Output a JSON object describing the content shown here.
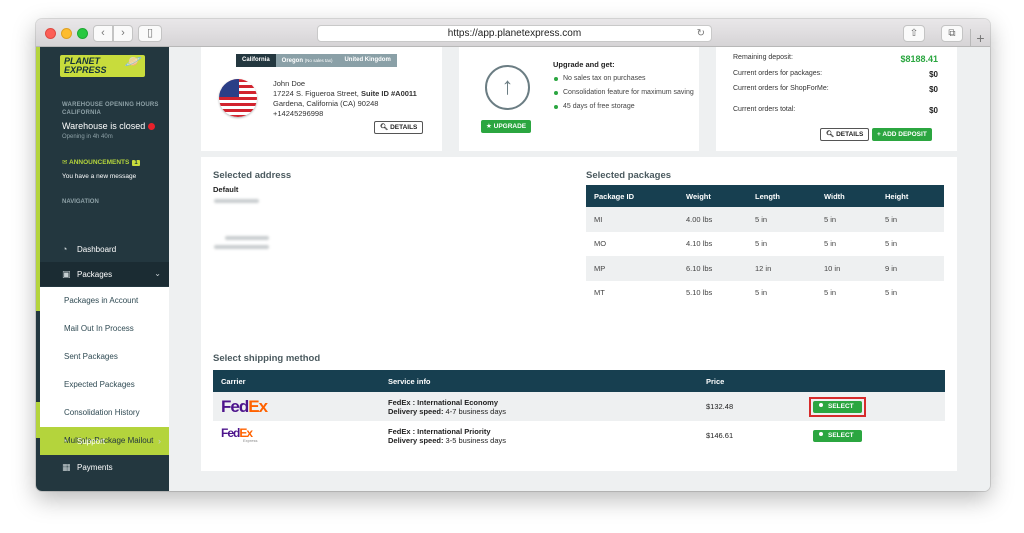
{
  "browser": {
    "url": "https://app.planetexpress.com",
    "reload_icon": "↻",
    "back_icon": "‹",
    "forward_icon": "›",
    "sidebar_icon": "▯",
    "share_icon": "⇧",
    "tabs_icon": "⧉",
    "newtab_icon": "+"
  },
  "sidebar": {
    "logo": "PLANET EXPRESS",
    "hours_title": "WAREHOUSE OPENING HOURS CALIFORNIA",
    "status": "Warehouse is closed",
    "opening": "Opening in 4h 40m",
    "announcements_label": "ANNOUNCEMENTS",
    "announcements_count": "1",
    "message": "You have a new message",
    "nav_heading": "NAVIGATION",
    "dashboard": "Dashboard",
    "packages": "Packages",
    "submenu": [
      "Packages in Account",
      "Mail Out In Process",
      "Sent Packages",
      "Expected Packages",
      "Consolidation History",
      "Multiple-Package Mailout"
    ],
    "support": "Support",
    "payments": "Payments"
  },
  "address_card": {
    "tabs": [
      "California",
      "Oregon",
      "(No sales tax)",
      "United Kingdom"
    ],
    "name": "John Doe",
    "street": "17224 S. Figueroa Street,",
    "suite": "Suite ID #A0011",
    "city": "Gardena, California (CA) 90248",
    "phone": "+14245296998",
    "details_btn": "DETAILS"
  },
  "upgrade_card": {
    "title": "Upgrade and get:",
    "benefits": [
      "No sales tax on purchases",
      "Consolidation feature for maximum saving",
      "45 days of free storage"
    ],
    "button": "UPGRADE"
  },
  "deposit_card": {
    "remaining_label": "Remaining deposit:",
    "remaining_value": "$8188.41",
    "orders_packages_label": "Current orders for packages:",
    "orders_packages_value": "$0",
    "orders_shop_label": "Current orders for ShopForMe:",
    "orders_shop_value": "$0",
    "orders_total_label": "Current orders total:",
    "orders_total_value": "$0",
    "details_btn": "DETAILS",
    "add_btn": "ADD DEPOSIT"
  },
  "selected_address": {
    "title": "Selected address",
    "default_label": "Default"
  },
  "selected_packages": {
    "title": "Selected packages",
    "columns": [
      "Package ID",
      "Weight",
      "Length",
      "Width",
      "Height"
    ],
    "rows": [
      [
        "MI",
        "4.00 lbs",
        "5 in",
        "5 in",
        "5 in"
      ],
      [
        "MO",
        "4.10 lbs",
        "5 in",
        "5 in",
        "5 in"
      ],
      [
        "MP",
        "6.10 lbs",
        "12 in",
        "10 in",
        "9 in"
      ],
      [
        "MT",
        "5.10 lbs",
        "5 in",
        "5 in",
        "5 in"
      ]
    ]
  },
  "shipping": {
    "title": "Select shipping method",
    "columns": [
      "Carrier",
      "Service info",
      "Price",
      ""
    ],
    "options": [
      {
        "carrier_fed": "Fed",
        "carrier_ex": "Ex",
        "carrier_sub": "",
        "service": "FedEx : International Economy",
        "speed_label": "Delivery speed:",
        "speed": "4-7 business days",
        "price": "$132.48",
        "select": "SELECT"
      },
      {
        "carrier_fed": "Fed",
        "carrier_ex": "Ex",
        "carrier_sub": "Express",
        "service": "FedEx : International Priority",
        "speed_label": "Delivery speed:",
        "speed": "3-5 business days",
        "price": "$146.61",
        "select": "SELECT"
      }
    ]
  },
  "colors": {
    "sidebar_bg": "#23373f",
    "accent_green": "#b4d43c",
    "button_green": "#2ba640",
    "table_header": "#173f50",
    "highlight_red": "#d62b2b"
  }
}
